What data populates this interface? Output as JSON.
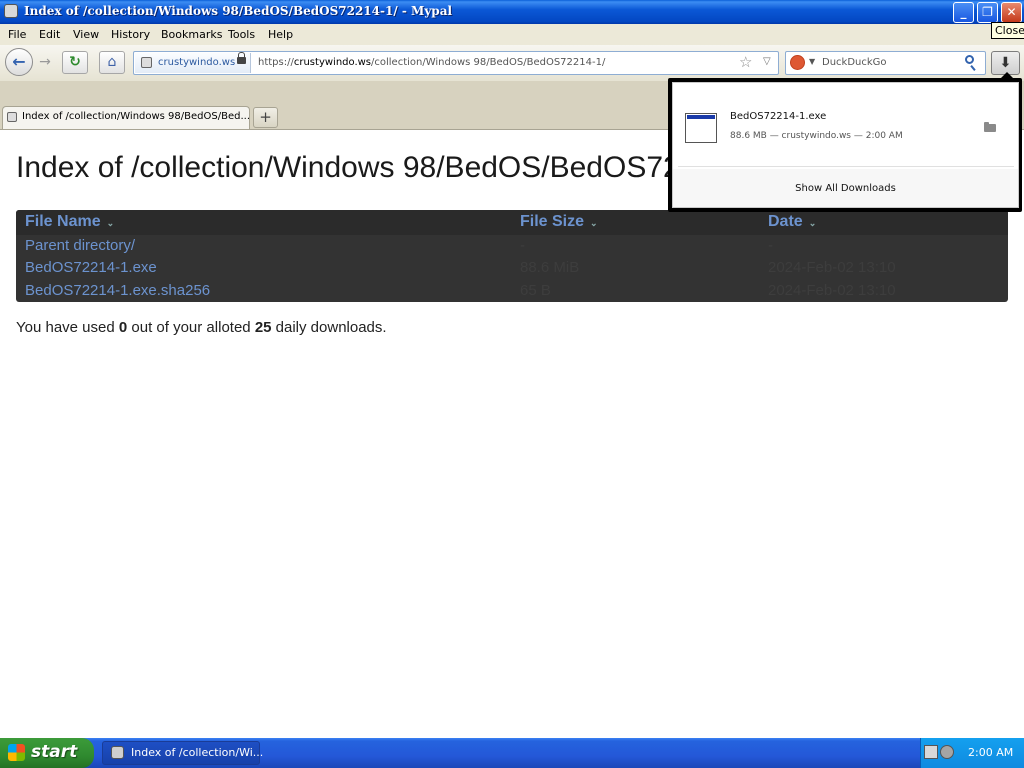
{
  "window": {
    "title": "Index of /collection/Windows 98/BedOS/BedOS72214-1/ - Mypal",
    "minimize": "_",
    "maximize": "❐",
    "close": "✕",
    "close_tooltip": "Close"
  },
  "menu": [
    "File",
    "Edit",
    "View",
    "History",
    "Bookmarks",
    "Tools",
    "Help"
  ],
  "navbar": {
    "identity_host": "crustywindo.ws",
    "url_prefix": "https://",
    "url_host": "crustywindo.ws",
    "url_path": "/collection/Windows 98/BedOS/BedOS72214-1/",
    "search_placeholder": "DuckDuckGo"
  },
  "tabs": [
    {
      "label": "Index of /collection/Windows 98/BedOS/Bed..."
    }
  ],
  "page": {
    "title": "Index of /collection/Windows 98/BedOS/BedOS72214-1/",
    "columns": [
      "File Name",
      "File Size",
      "Date"
    ],
    "rows": [
      {
        "name": "Parent directory/",
        "size": "-",
        "date": "-"
      },
      {
        "name": "BedOS72214-1.exe",
        "size": "88.6 MiB",
        "date": "2024-Feb-02 13:10"
      },
      {
        "name": "BedOS72214-1.exe.sha256",
        "size": "65 B",
        "date": "2024-Feb-02 13:10"
      }
    ],
    "quota": {
      "prefix": "You have used ",
      "used": "0",
      "middle": " out of your alloted ",
      "limit": "25",
      "suffix": " daily downloads."
    }
  },
  "downloads_panel": {
    "filename": "BedOS72214-1.exe",
    "details": "88.6 MB — crustywindo.ws — 2:00 AM",
    "show_all": "Show All Downloads"
  },
  "taskbar": {
    "start": "start",
    "task": "Index of /collection/Wi...",
    "clock": "2:00 AM"
  }
}
